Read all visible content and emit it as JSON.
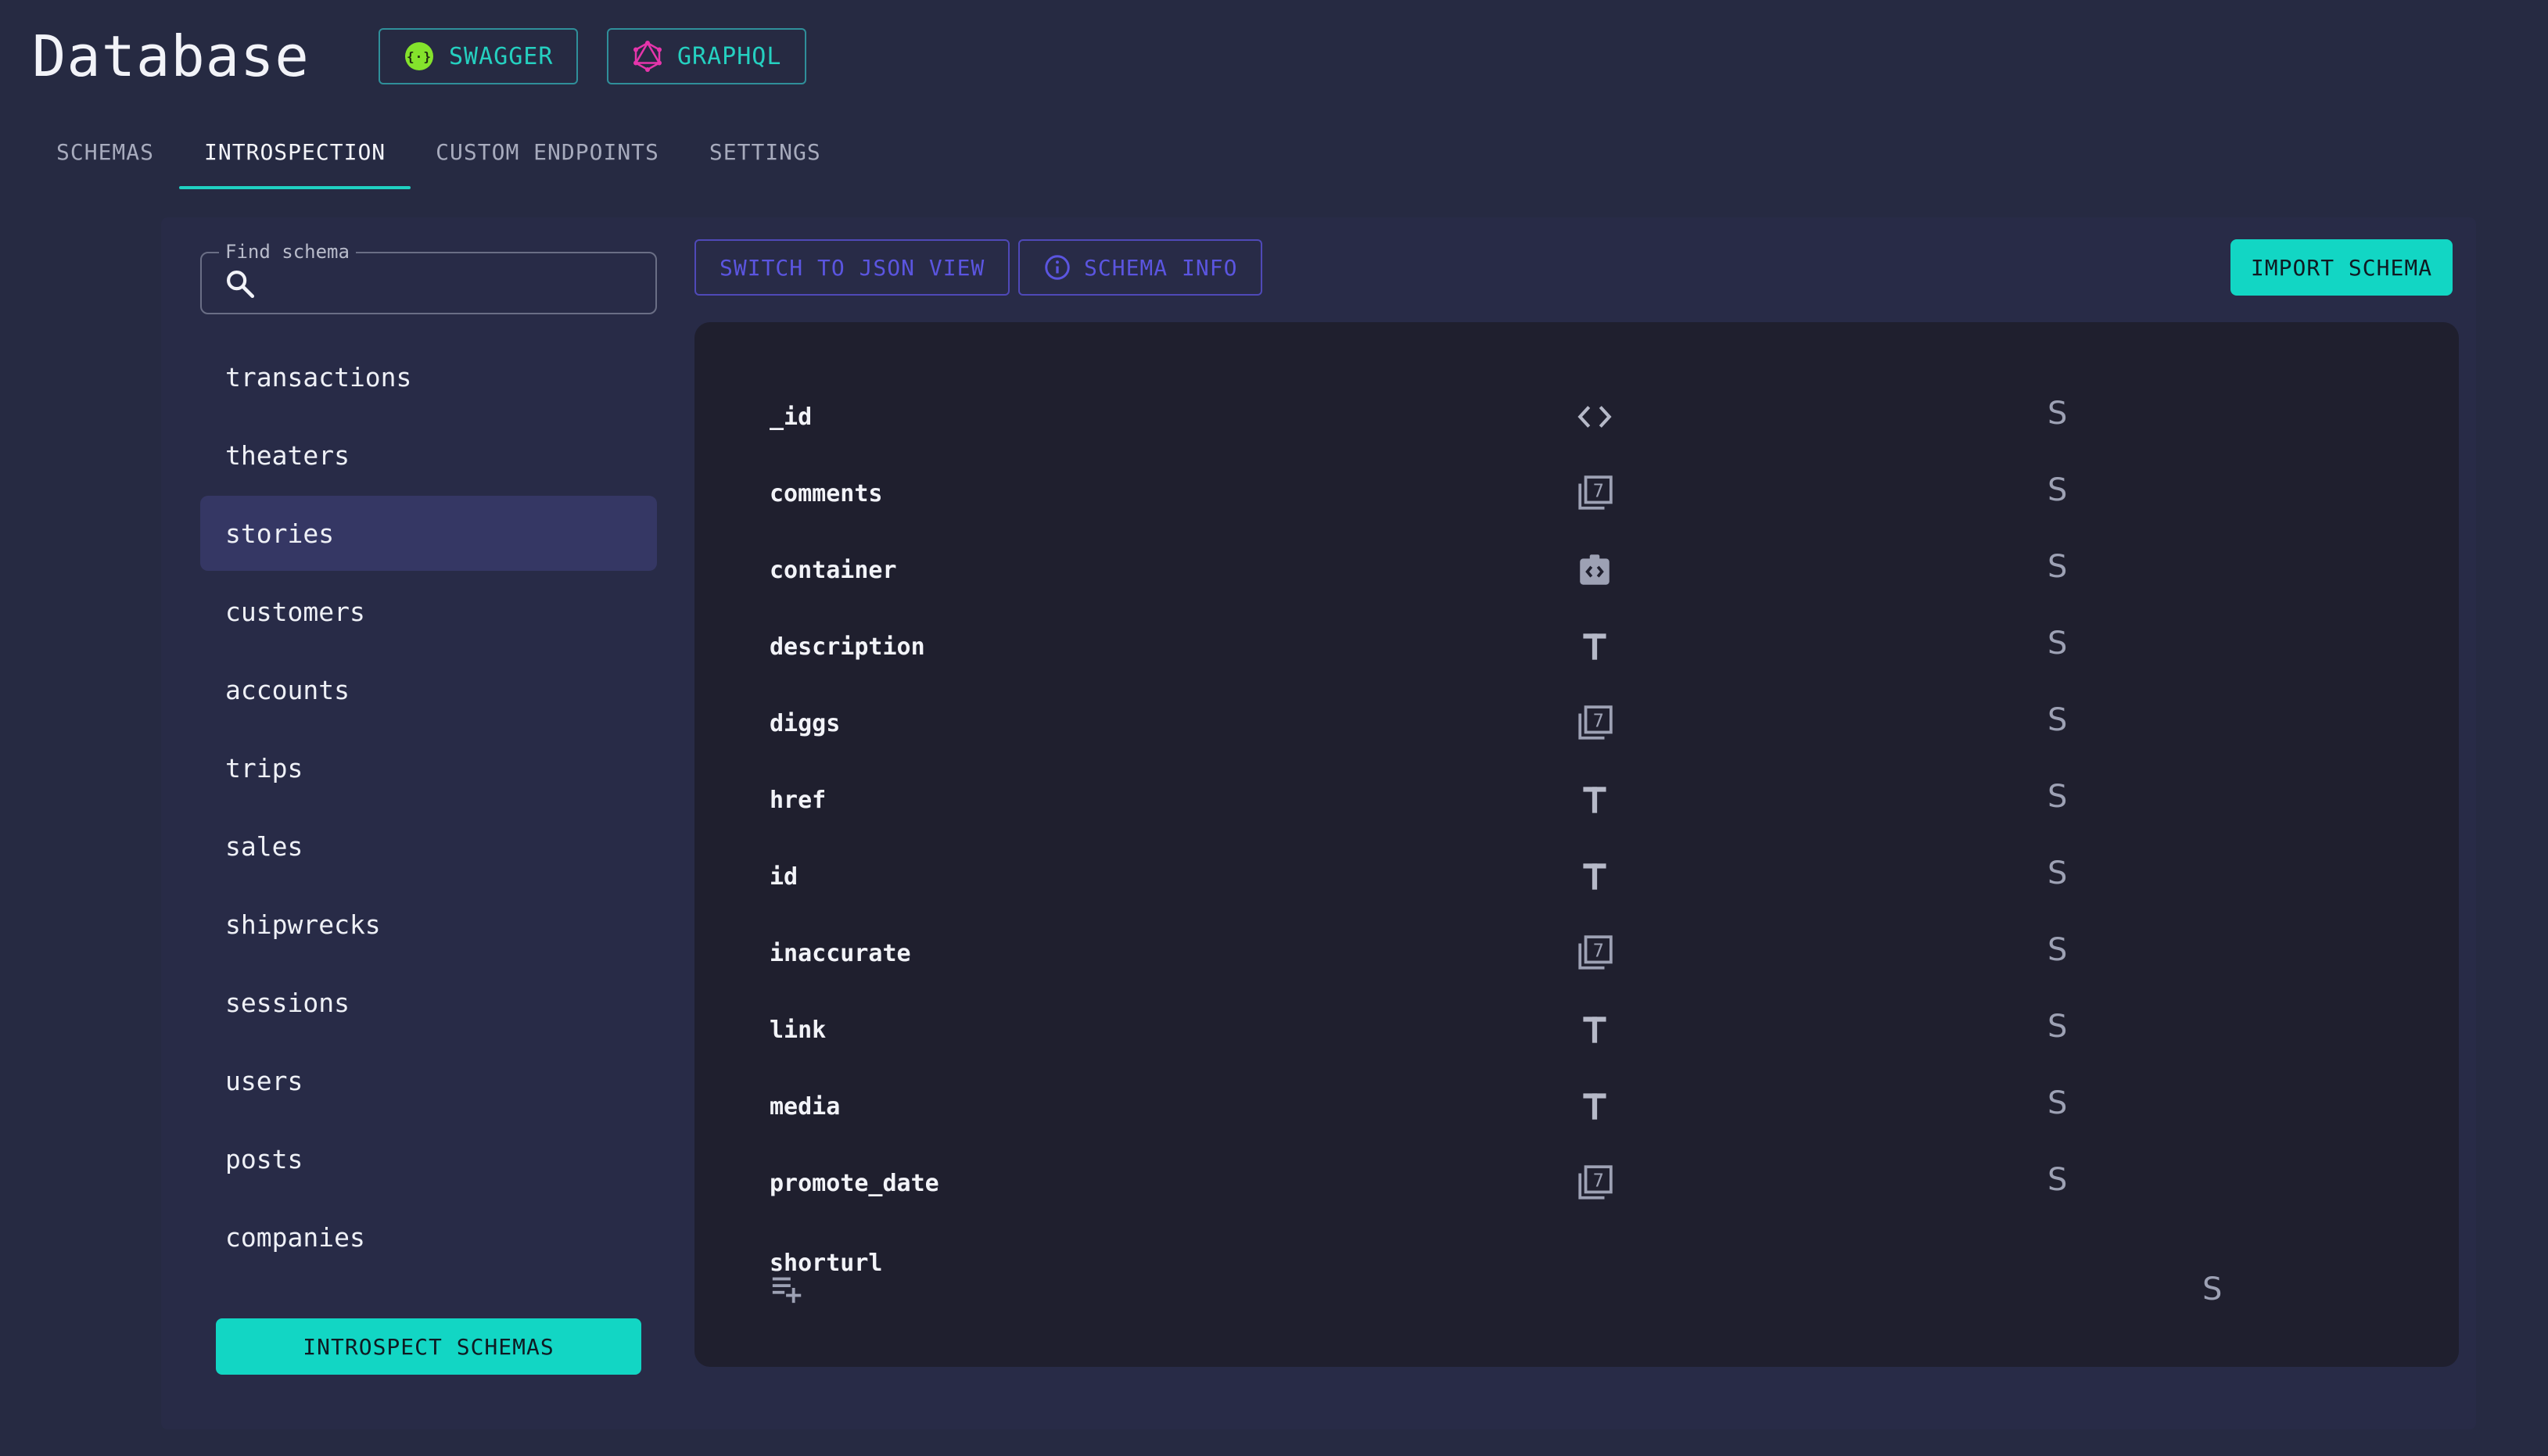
{
  "app": {
    "title": "Database"
  },
  "api_buttons": {
    "swagger": "SWAGGER",
    "graphql": "GRAPHQL"
  },
  "tabs": [
    {
      "label": "SCHEMAS",
      "active": false
    },
    {
      "label": "INTROSPECTION",
      "active": true
    },
    {
      "label": "CUSTOM ENDPOINTS",
      "active": false
    },
    {
      "label": "SETTINGS",
      "active": false
    }
  ],
  "search": {
    "label": "Find schema",
    "value": ""
  },
  "schemas": [
    {
      "name": "transactions",
      "selected": false
    },
    {
      "name": "theaters",
      "selected": false
    },
    {
      "name": "stories",
      "selected": true
    },
    {
      "name": "customers",
      "selected": false
    },
    {
      "name": "accounts",
      "selected": false
    },
    {
      "name": "trips",
      "selected": false
    },
    {
      "name": "sales",
      "selected": false
    },
    {
      "name": "shipwrecks",
      "selected": false
    },
    {
      "name": "sessions",
      "selected": false
    },
    {
      "name": "users",
      "selected": false
    },
    {
      "name": "posts",
      "selected": false
    },
    {
      "name": "companies",
      "selected": false
    }
  ],
  "actions": {
    "introspect": "INTROSPECT SCHEMAS",
    "json_view": "SWITCH TO JSON VIEW",
    "schema_info": "SCHEMA INFO",
    "import": "IMPORT SCHEMA"
  },
  "fields": [
    {
      "name": "_id",
      "type_icon": "code-icon",
      "flag": "S"
    },
    {
      "name": "comments",
      "type_icon": "number-icon",
      "flag": "S"
    },
    {
      "name": "container",
      "type_icon": "object-icon",
      "flag": "S"
    },
    {
      "name": "description",
      "type_icon": "text-icon",
      "flag": "S"
    },
    {
      "name": "diggs",
      "type_icon": "number-icon",
      "flag": "S"
    },
    {
      "name": "href",
      "type_icon": "text-icon",
      "flag": "S"
    },
    {
      "name": "id",
      "type_icon": "text-icon",
      "flag": "S"
    },
    {
      "name": "inaccurate",
      "type_icon": "number-icon",
      "flag": "S"
    },
    {
      "name": "link",
      "type_icon": "text-icon",
      "flag": "S"
    },
    {
      "name": "media",
      "type_icon": "text-icon",
      "flag": "S"
    },
    {
      "name": "promote_date",
      "type_icon": "number-icon",
      "flag": "S"
    }
  ],
  "last_field": {
    "name": "shorturl",
    "icon": "playlist-add-icon",
    "flag": "S"
  },
  "colors": {
    "background": "#262a42",
    "panel": "#282b47",
    "fields_bg": "#1f1f2e",
    "accent_teal": "#12d6c4",
    "accent_purple": "#5b55e0",
    "selected_item": "#353764"
  }
}
